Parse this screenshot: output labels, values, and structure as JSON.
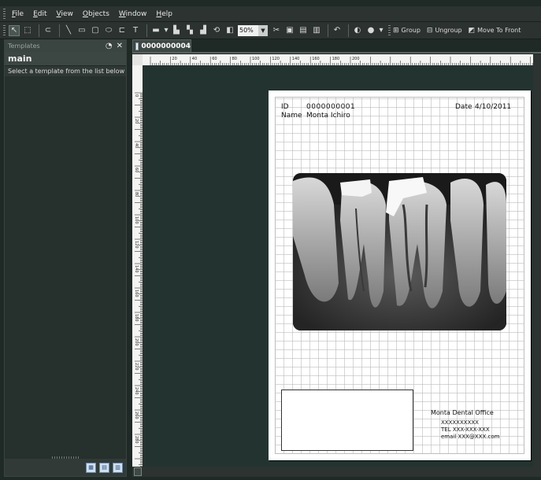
{
  "menu": [
    "File",
    "Edit",
    "View",
    "Objects",
    "Window",
    "Help"
  ],
  "toolbar": {
    "zoom_value": "50%",
    "group_label": "Group",
    "ungroup_label": "Ungroup",
    "move_to_front_label": "Move To Front"
  },
  "left_panel": {
    "title": "Templates",
    "template_name": "main",
    "hint": "Select a template from the list below"
  },
  "document_tab": {
    "label": "0000000004"
  },
  "ruler": {
    "h_labels": [
      "20",
      "40",
      "60",
      "80",
      "100",
      "120",
      "140",
      "160",
      "180",
      "200"
    ],
    "v_labels": [
      "0",
      "20",
      "40",
      "60",
      "80",
      "100",
      "120",
      "140",
      "160",
      "180",
      "200",
      "220",
      "240",
      "260",
      "280"
    ]
  },
  "page": {
    "id_label": "ID",
    "id_value": "0000000001",
    "date_label": "Date",
    "date_value": "4/10/2011",
    "name_label": "Name",
    "name_value": "Monta Ichiro",
    "office_name": "Monta Dental Office",
    "office_code": "XXXXXXXXXX",
    "office_tel": "TEL XXX-XXX-XXX",
    "office_email": "email XXX@XXX.com"
  }
}
